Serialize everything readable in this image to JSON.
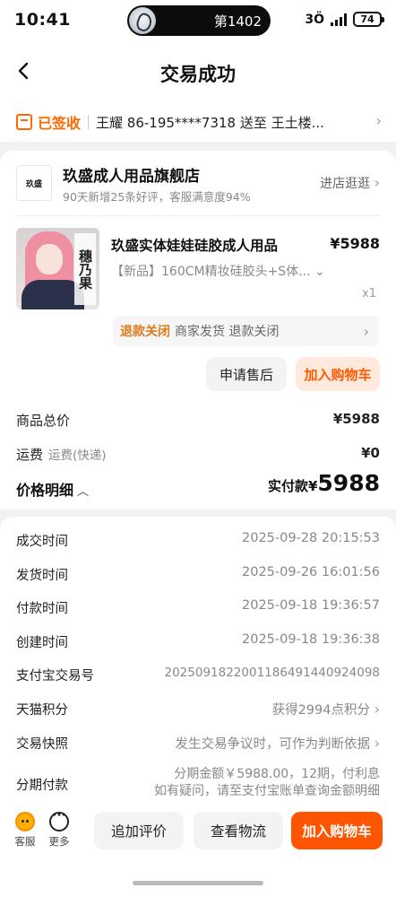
{
  "status_bar": {
    "time": "10:41",
    "island_text": "第1402",
    "battery": "74",
    "vibrate_label": "3Ö"
  },
  "header": {
    "title": "交易成功"
  },
  "logistics": {
    "status": "已签收",
    "text": "王耀 86-195****7318 送至 王土楼..."
  },
  "shop": {
    "logo_text": "玖盛",
    "name": "玖盛成人用品旗舰店",
    "subtitle": "90天新增25条好评，客服满意度94%",
    "link_label": "进店逛逛"
  },
  "product": {
    "image_tag": "穗乃果",
    "title": "玖盛实体娃娃硅胶成人用品",
    "price": "¥5988",
    "spec": "【新品】160CM精妆硅胶头+S体...",
    "quantity": "x1"
  },
  "refund": {
    "status": "退款关闭",
    "desc": "商家发货 退款关闭"
  },
  "actions": {
    "after_sale_label": "申请售后",
    "add_cart_label": "加入购物车"
  },
  "fees": {
    "total_label": "商品总价",
    "total_value": "¥5988",
    "shipping_label": "运费",
    "shipping_sub": "运费(快递)",
    "shipping_value": "¥0"
  },
  "price_detail": {
    "label": "价格明细",
    "paid_label": "实付款¥",
    "paid_value": "5988"
  },
  "details": [
    {
      "key": "成交时间",
      "value": "2025-09-28 20:15:53"
    },
    {
      "key": "发货时间",
      "value": "2025-09-26 16:01:56"
    },
    {
      "key": "付款时间",
      "value": "2025-09-18 19:36:57"
    },
    {
      "key": "创建时间",
      "value": "2025-09-18 19:36:38"
    },
    {
      "key": "支付宝交易号",
      "value": "2025091822001186491440924098"
    },
    {
      "key": "天猫积分",
      "value": "获得2994点积分"
    },
    {
      "key": "交易快照",
      "value": "发生交易争议时，可作为判断依据"
    }
  ],
  "installment": {
    "key": "分期付款",
    "line1": "分期金额￥5988.00，12期，付利息",
    "line2": "如有疑问，请至支付宝账单查询金额明细"
  },
  "bottom_bar": {
    "service_label": "客服",
    "more_label": "更多",
    "review_label": "追加评价",
    "logistics_label": "查看物流",
    "cart_label": "加入购物车"
  },
  "colors": {
    "accent": "#ff5500",
    "status_orange": "#ff6a00",
    "background": "#f2f2f2"
  }
}
